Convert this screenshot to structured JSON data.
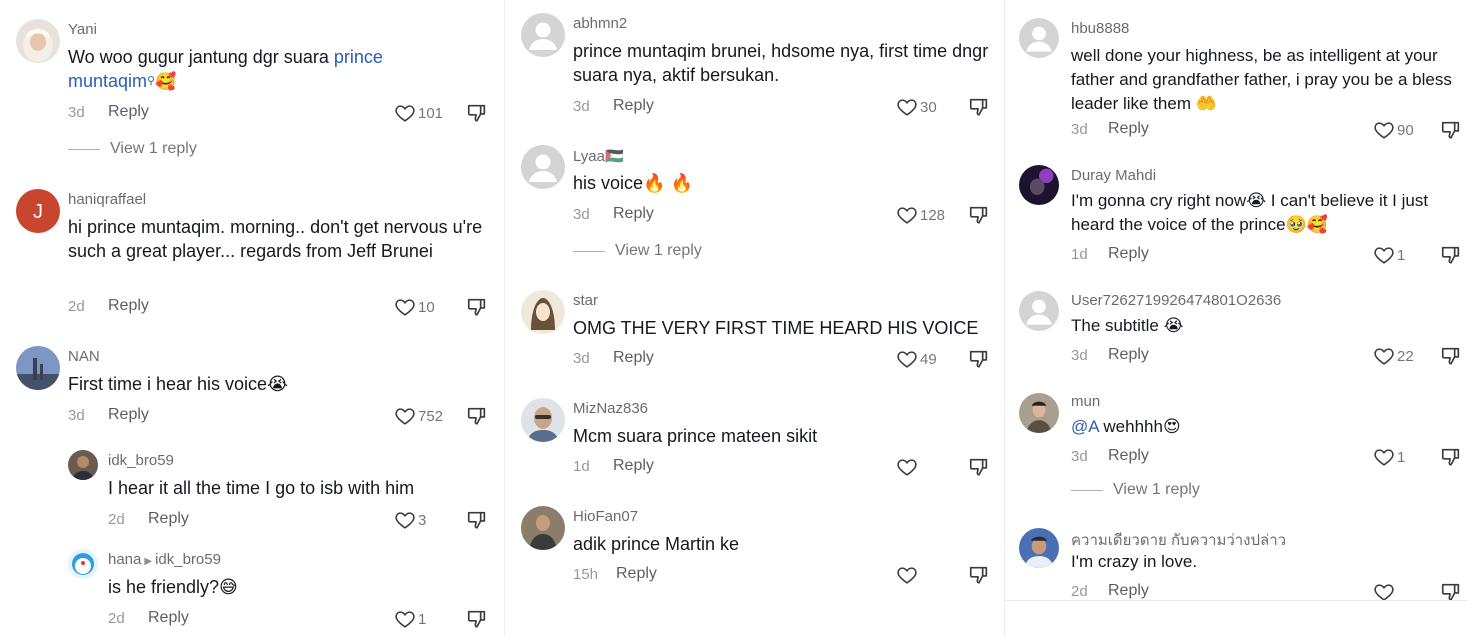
{
  "columns": [
    {
      "comments": [
        {
          "user": "Yani",
          "text_a": "Wo woo gugur jantung dgr suara ",
          "link": "prince muntaqim",
          "text_b": "🥰",
          "time": "3d",
          "reply": "Reply",
          "likes": "101",
          "view_replies": "View 1 reply"
        },
        {
          "user": "haniqraffael",
          "text": "hi prince muntaqim. morning.. don't get nervous u're such a great player... regards from Jeff Brunei",
          "time": "2d",
          "reply": "Reply",
          "likes": "10"
        },
        {
          "user": "NAN",
          "text": "First time i hear his voice😭",
          "time": "3d",
          "reply": "Reply",
          "likes": "752"
        },
        {
          "user": "idk_bro59",
          "text": "I hear it all the time I go to isb with him",
          "time": "2d",
          "reply": "Reply",
          "likes": "3"
        },
        {
          "user": "hana",
          "reply_to": "idk_bro59",
          "text": "is he friendly?😅",
          "time": "2d",
          "reply": "Reply",
          "likes": "1"
        }
      ]
    },
    {
      "comments": [
        {
          "user": "abhmn2",
          "text": "prince muntaqim brunei, hdsome nya, first time dngr suara nya, aktif bersukan.",
          "time": "3d",
          "reply": "Reply",
          "likes": "30"
        },
        {
          "user": "Lyaa🇵🇸",
          "text": "his voice🔥 🔥",
          "time": "3d",
          "reply": "Reply",
          "likes": "128",
          "view_replies": "View 1 reply"
        },
        {
          "user": "star",
          "text": "OMG THE VERY FIRST TIME HEARD HIS VOICE",
          "time": "3d",
          "reply": "Reply",
          "likes": "49"
        },
        {
          "user": "MizNaz836",
          "text": "Mcm suara prince mateen sikit",
          "time": "1d",
          "reply": "Reply",
          "likes": ""
        },
        {
          "user": "HioFan07",
          "text": "adik prince Martin ke",
          "time": "15h",
          "reply": "Reply",
          "likes": ""
        }
      ]
    },
    {
      "comments": [
        {
          "user": "hbu8888",
          "text": "well done your highness, be as intelligent at your father and grandfather father, i pray you be a bless leader like them 🤲",
          "time": "3d",
          "reply": "Reply",
          "likes": "90"
        },
        {
          "user": "Duray Mahdi",
          "text": "I'm gonna cry right now😭 I can't believe it I just heard the voice of the prince🥹🥰",
          "time": "1d",
          "reply": "Reply",
          "likes": "1"
        },
        {
          "user": "User7262719926474801O2636",
          "text": "The subtitle 😭",
          "time": "3d",
          "reply": "Reply",
          "likes": "22"
        },
        {
          "user": "mun",
          "mention": "@A",
          "text": " wehhhh😍",
          "time": "3d",
          "reply": "Reply",
          "likes": "1",
          "view_replies": "View 1 reply"
        },
        {
          "user": "ความเดียวดาย กับความว่างปล่าว",
          "text": "I'm crazy in love.",
          "time": "2d",
          "reply": "Reply",
          "likes": ""
        }
      ]
    }
  ],
  "icons": {
    "like": "heart-outline-icon",
    "dislike": "thumbs-down-icon",
    "default_avatar": "default-avatar-icon"
  },
  "colors": {
    "link": "#2b5db9",
    "text": "#161823",
    "avatar_red": "#c8462f"
  }
}
